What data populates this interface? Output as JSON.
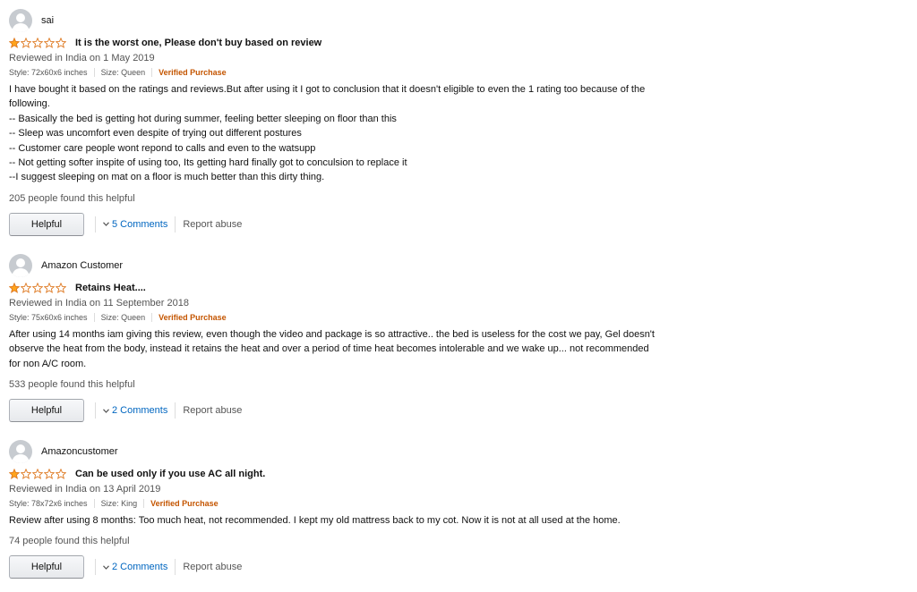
{
  "colors": {
    "star_fill": "#ffa41c",
    "star_outline": "#de7921",
    "verified": "#c45500",
    "link": "#0066c0"
  },
  "icons": {
    "avatar": "default-user-avatar-icon",
    "star_full": "star-filled-icon",
    "star_empty": "star-empty-icon",
    "chevron": "chevron-down-icon"
  },
  "reviews": [
    {
      "profile_name": "sai",
      "rating": 1,
      "max_rating": 5,
      "title": "It is the worst one, Please don't buy based on review",
      "date": "Reviewed in India on 1 May 2019",
      "style": "Style: 72x60x6 inches",
      "size": "Size: Queen",
      "verified": "Verified Purchase",
      "body_lines": [
        "I have bought it based on the ratings and reviews.But after using it I got to conclusion that it doesn't eligible to even the 1 rating too because of the",
        "following.",
        "-- Basically the bed is getting hot during summer, feeling better sleeping on floor than this",
        "-- Sleep was uncomfort even despite of trying out different postures",
        "-- Customer care people wont repond to calls and even to the watsupp",
        "-- Not getting softer inspite of using too, Its getting hard finally got to conculsion to replace it",
        "--I suggest sleeping on mat on a floor is much better than this dirty thing."
      ],
      "helpful_count": "205 people found this helpful",
      "helpful_label": "Helpful",
      "comments_label": "5 Comments",
      "report_label": "Report abuse"
    },
    {
      "profile_name": "Amazon Customer",
      "rating": 1,
      "max_rating": 5,
      "title": "Retains Heat....",
      "date": "Reviewed in India on 11 September 2018",
      "style": "Style: 75x60x6 inches",
      "size": "Size: Queen",
      "verified": "Verified Purchase",
      "body_lines": [
        "After using 14 months iam giving this review, even though the video and package is so attractive.. the bed is useless for the cost we pay, Gel doesn't",
        "observe the heat from the body, instead it retains the heat and over a period of time heat becomes intolerable and we wake up... not recommended",
        "for non A/C room."
      ],
      "helpful_count": "533 people found this helpful",
      "helpful_label": "Helpful",
      "comments_label": "2 Comments",
      "report_label": "Report abuse"
    },
    {
      "profile_name": "Amazoncustomer",
      "rating": 1,
      "max_rating": 5,
      "title": "Can be used only if you use AC all night.",
      "date": "Reviewed in India on 13 April 2019",
      "style": "Style: 78x72x6 inches",
      "size": "Size: King",
      "verified": "Verified Purchase",
      "body_lines": [
        "Review after using 8 months: Too much heat, not recommended. I kept my old mattress back to my cot. Now it is not at all used at the home."
      ],
      "helpful_count": "74 people found this helpful",
      "helpful_label": "Helpful",
      "comments_label": "2 Comments",
      "report_label": "Report abuse"
    }
  ]
}
